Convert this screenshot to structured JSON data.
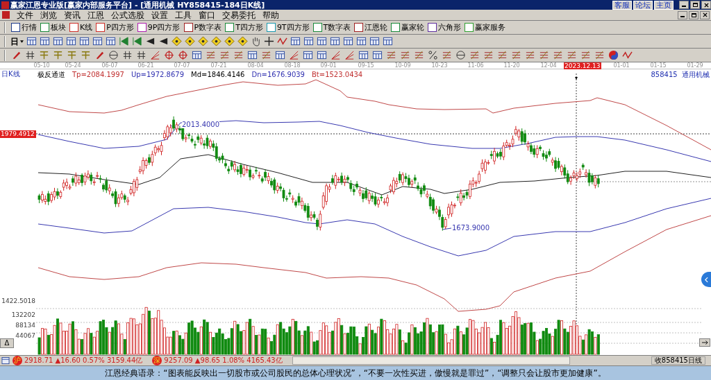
{
  "window": {
    "title": "赢家江恩专业版[赢家内部服务平台] - [通用机械   HY858415-184日K线]",
    "links": [
      "客服",
      "论坛",
      "主页"
    ]
  },
  "menu": [
    "文件",
    "浏览",
    "资讯",
    "江恩",
    "公式选股",
    "设置",
    "工具",
    "窗口",
    "交易委托",
    "帮助"
  ],
  "toolbar": [
    {
      "label": "行情",
      "color": "#1f3c8a"
    },
    {
      "label": "板块",
      "color": "#1a8a3a"
    },
    {
      "label": "K线",
      "color": "#d0302a"
    },
    {
      "label": "P四方形",
      "color": "#d0302a"
    },
    {
      "label": "9P四方形",
      "color": "#b020b0"
    },
    {
      "label": "P数字表",
      "color": "#a02020"
    },
    {
      "label": "T四方形",
      "color": "#1a8a3a"
    },
    {
      "label": "9T四方形",
      "color": "#1a9ab0"
    },
    {
      "label": "T数字表",
      "color": "#1a8a3a"
    },
    {
      "label": "江恩轮",
      "color": "#a02020"
    },
    {
      "label": "赢家轮",
      "color": "#1a8a3a"
    },
    {
      "label": "六角形",
      "color": "#6030a0"
    },
    {
      "label": "赢家服务",
      "color": "#30a030"
    }
  ],
  "period": {
    "label": "日"
  },
  "x_axis": [
    "05-10",
    "05-24",
    "06-07",
    "06-21",
    "07-07",
    "07-21",
    "08-04",
    "08-18",
    "09-01",
    "09-15",
    "10-09",
    "10-23",
    "11-06",
    "11-20",
    "12-04",
    "01-01",
    "01-15",
    "01-29"
  ],
  "cursor_date": "2023.12.13",
  "chart_label": "日K线",
  "indicator": {
    "name": "极反通道",
    "params": [
      {
        "text": "Tp=2084.1997",
        "color": "#c03030"
      },
      {
        "text": "Up=1972.8679",
        "color": "#3030b0"
      },
      {
        "text": "Md=1846.4146",
        "color": "#000000"
      },
      {
        "text": "Dn=1676.9039",
        "color": "#3030b0"
      },
      {
        "text": "Bt=1523.0434",
        "color": "#c03030"
      }
    ]
  },
  "stock": "858415  通用机械",
  "price_tag": "1979.4912",
  "annotations": [
    "2013.4000",
    "1673.9000"
  ],
  "volume_axis": [
    "1422.5018",
    "132202",
    "88134",
    "44067"
  ],
  "volume_toggle": "Δ",
  "status": {
    "indices": [
      {
        "badge": "沪",
        "text": "2918.71 ▲16.60 0.57% 3159.44亿"
      },
      {
        "badge": "深",
        "text": "9257.09 ▲98.65 1.08% 4165.43亿"
      }
    ],
    "right": "收858415日线"
  },
  "quote": "江恩经典语录：“图表能反映出一切股市或公司股民的总体心理状况”，“不要一次性买进，傲慢就是罪过”，“调整只会让股市更加健康”。"
}
